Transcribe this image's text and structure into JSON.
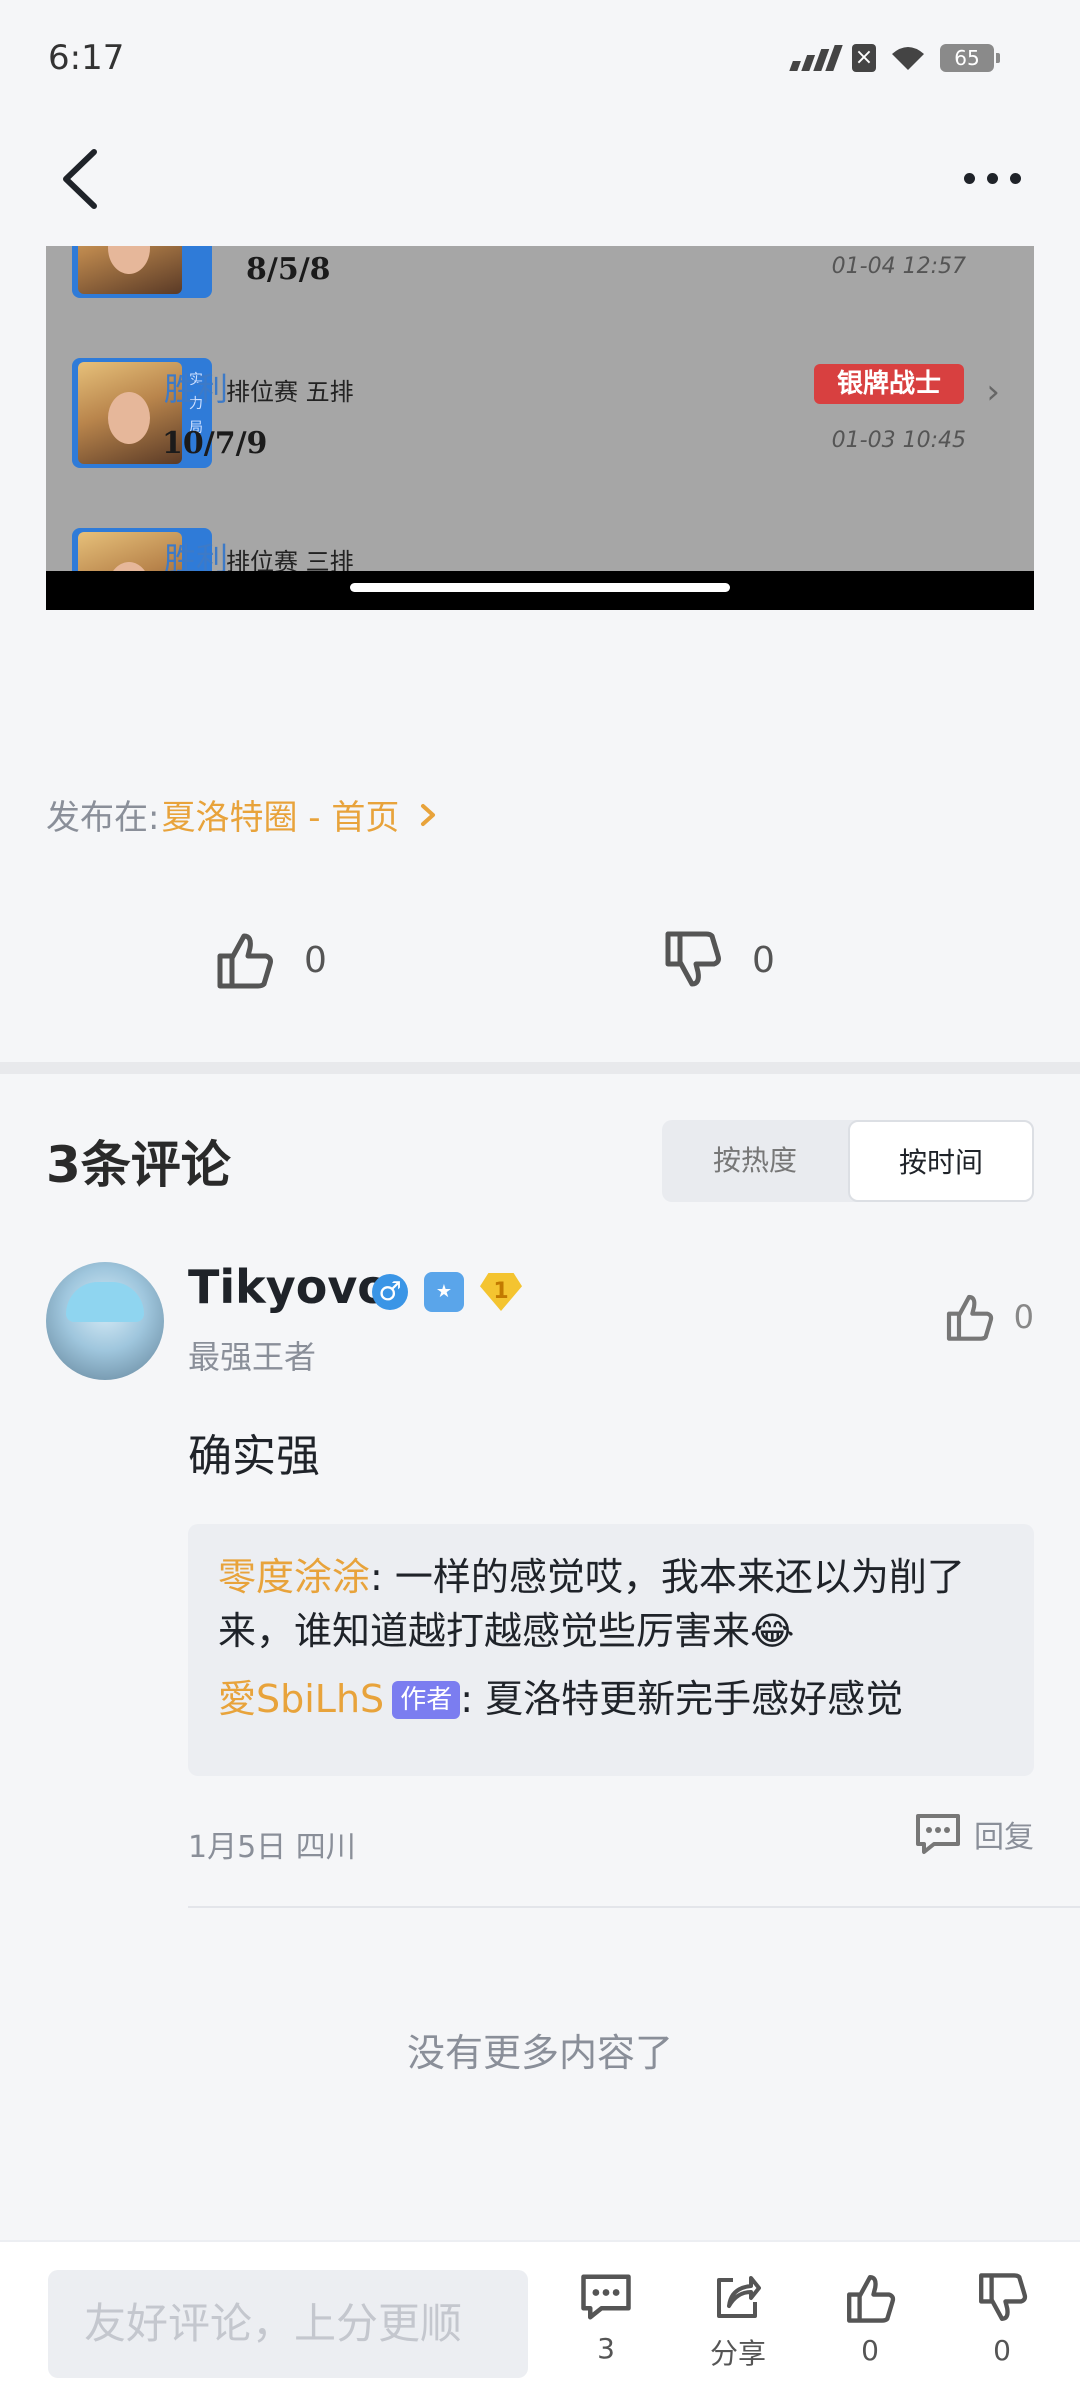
{
  "status_bar": {
    "time": "6:17",
    "battery": "65"
  },
  "embedded_image": {
    "rows": [
      {
        "kda": "8/5/8",
        "time": "01-04 12:57"
      },
      {
        "result": "胜利",
        "mode": "排位赛 五排",
        "kda": "10/7/9",
        "time": "01-03 10:45",
        "rank_badge": "银牌战士",
        "side": "实力局"
      },
      {
        "result": "胜利",
        "mode": "排位赛 三排"
      }
    ]
  },
  "post": {
    "published_prefix": "发布在:",
    "published_circle": "夏洛特圈 - 首页",
    "like_count": "0",
    "dislike_count": "0"
  },
  "comments": {
    "title": "3条评论",
    "sort_options": [
      "按热度",
      "按时间"
    ],
    "active_sort": "按时间",
    "items": [
      {
        "user": "Tikyovo",
        "rank": "最强王者",
        "text": "确实强",
        "likes": "0",
        "meta": "1月5日 四川",
        "reply_label": "回复",
        "replies": [
          {
            "name": "零度涂涂",
            "sep": ":",
            "text": "一样的感觉哎，我本来还以为削了来，谁知道越打越感觉些厉害来😂"
          },
          {
            "name": "愛SbiLhS",
            "tag": "作者",
            "sep": ":",
            "text": "夏洛特更新完手感好感觉"
          }
        ]
      }
    ],
    "no_more": "没有更多内容了"
  },
  "bottom_bar": {
    "placeholder": "友好评论，上分更顺",
    "comment_count": "3",
    "share_label": "分享",
    "like_count": "0",
    "dislike_count": "0"
  },
  "colors": {
    "accent": "#e8a33b",
    "author_tag": "#7b7df0",
    "background": "#f5f6f8"
  }
}
